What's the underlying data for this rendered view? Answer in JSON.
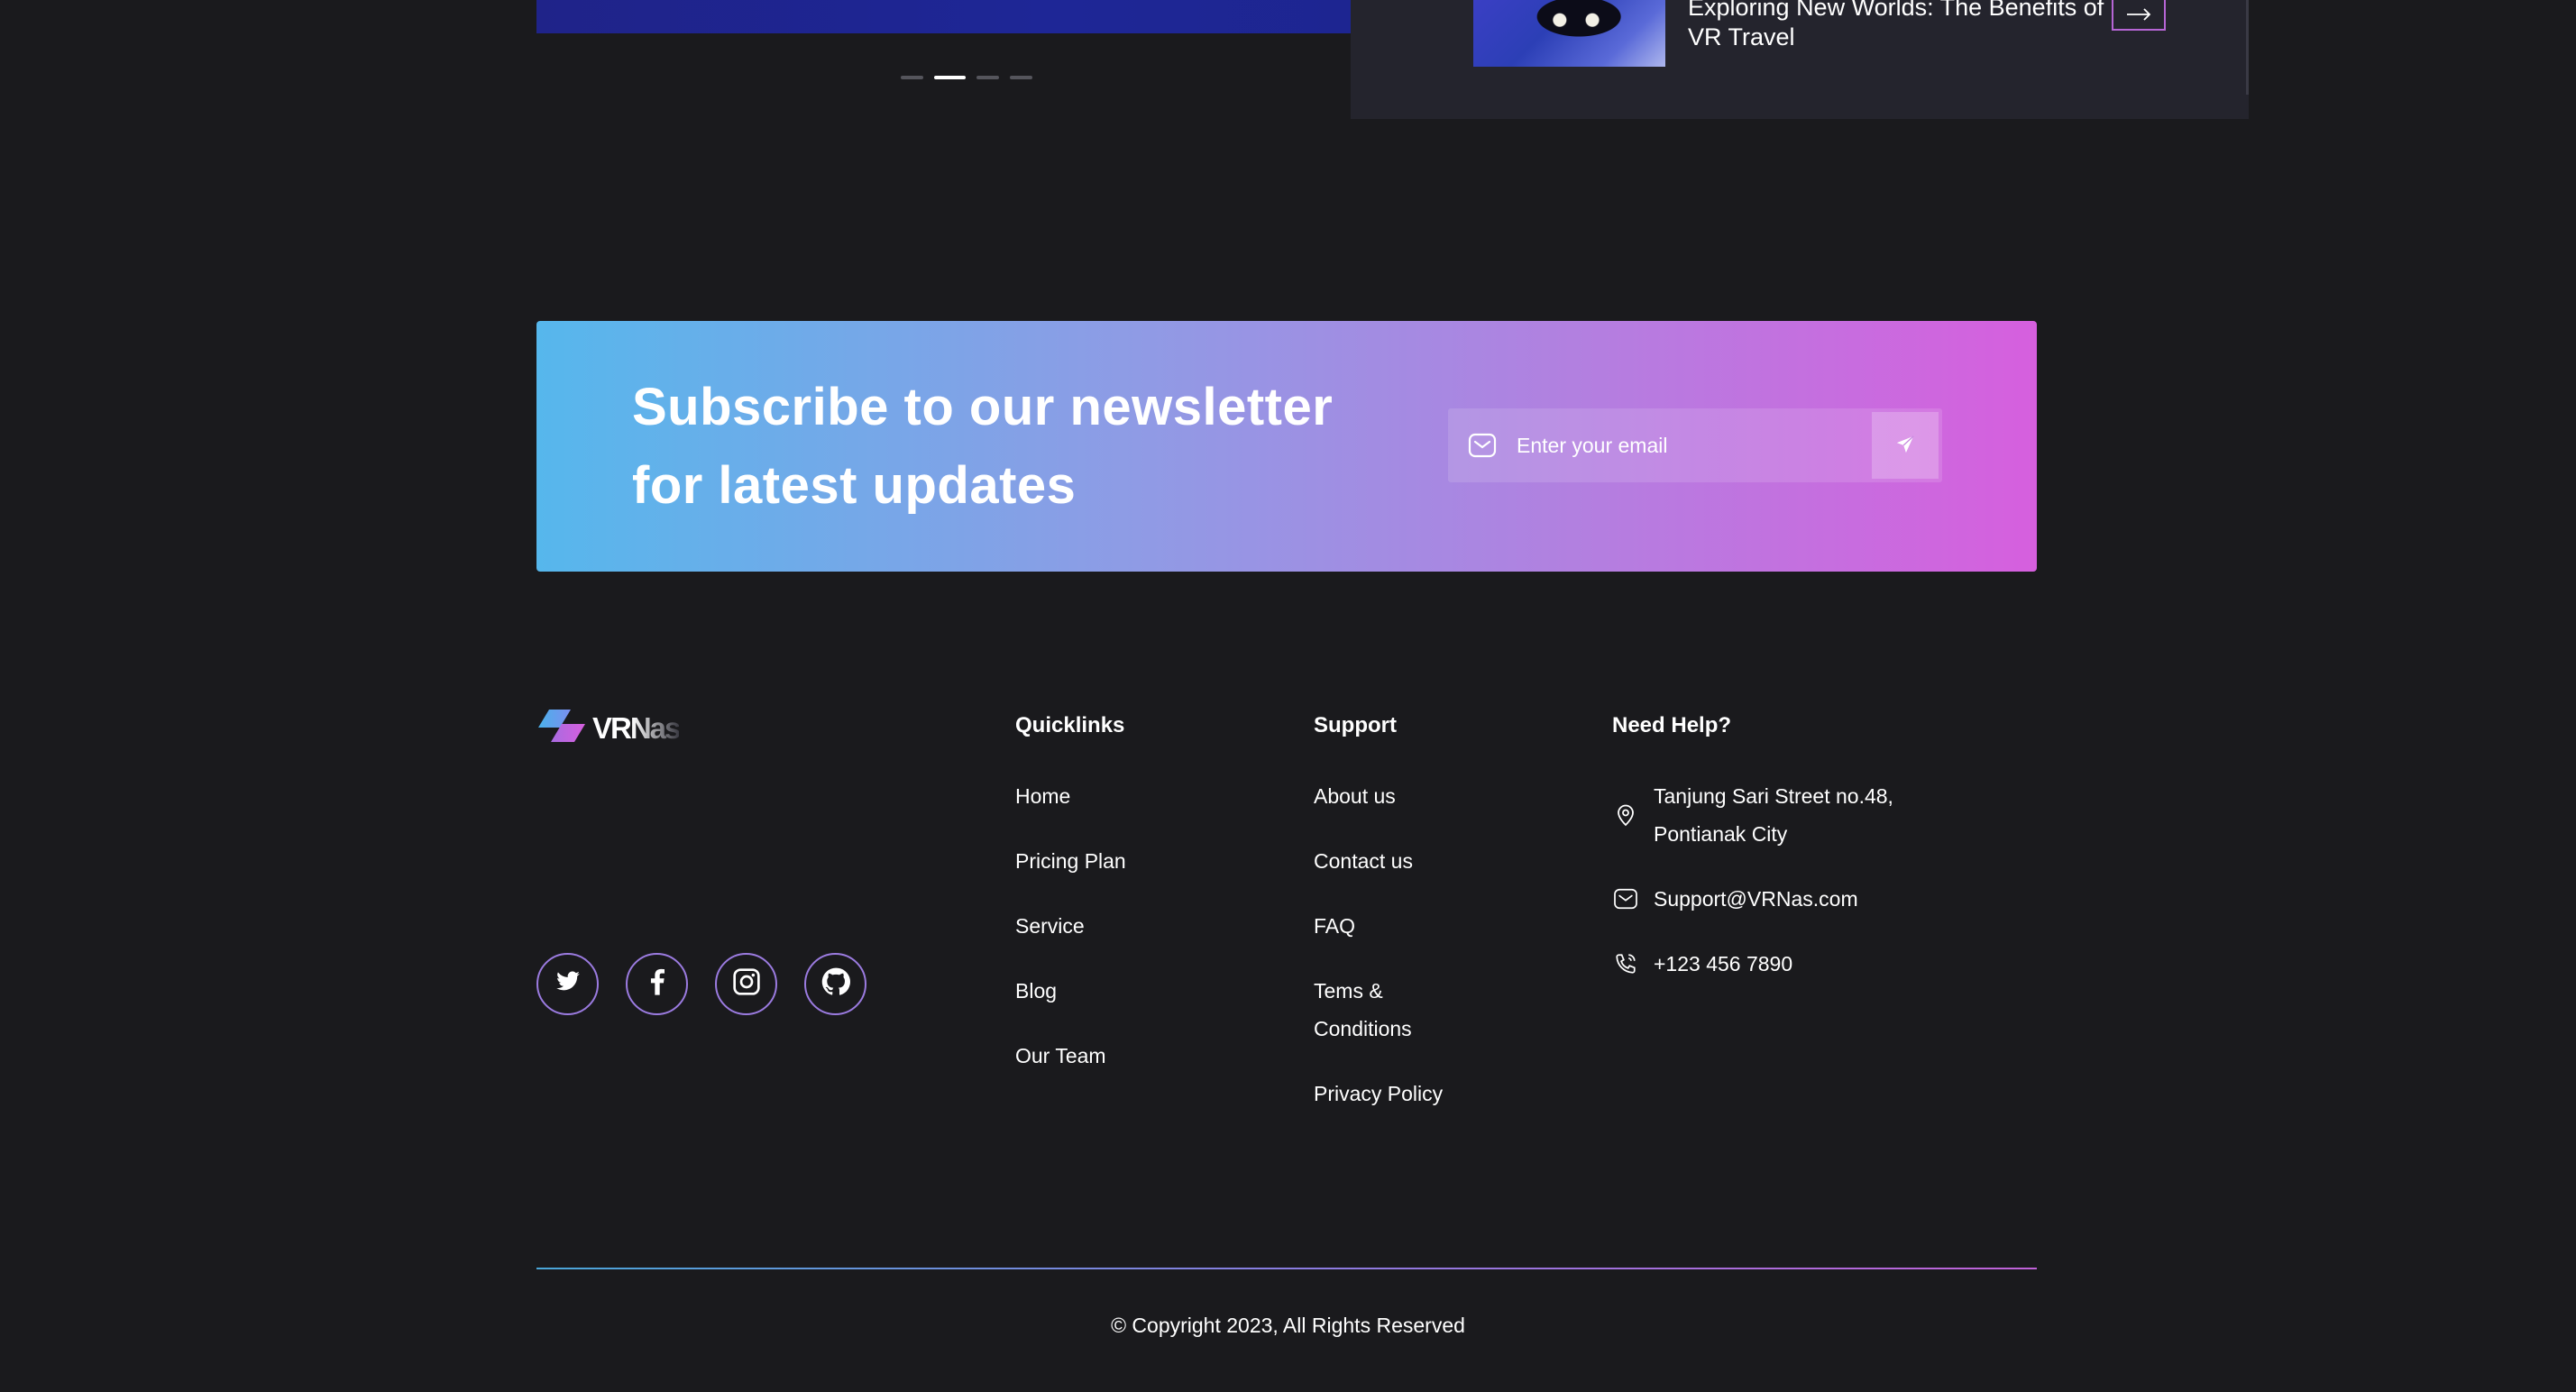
{
  "blog": {
    "title": "Exploring New Worlds: The Benefits of VR Travel"
  },
  "carousel": {
    "dots": 4,
    "active_index": 1
  },
  "newsletter": {
    "title": "Subscribe to our newsletter for latest updates",
    "email_placeholder": "Enter your email",
    "icons": [
      "mail-icon",
      "send-icon"
    ]
  },
  "footer": {
    "logo_text": "VRNas",
    "socials": [
      "twitter-icon",
      "facebook-icon",
      "instagram-icon",
      "github-icon"
    ],
    "quicklinks": {
      "heading": "Quicklinks",
      "items": [
        "Home",
        "Pricing Plan",
        "Service",
        "Blog",
        "Our Team"
      ]
    },
    "support": {
      "heading": "Support",
      "items": [
        "About us",
        "Contact us",
        "FAQ",
        "Tems & Conditions",
        "Privacy Policy"
      ]
    },
    "help": {
      "heading": "Need Help?",
      "address": "Tanjung Sari Street no.48, Pontianak City",
      "email": "Support@VRNas.com",
      "phone": "+123 456 7890"
    },
    "copyright": "© Copyright 2023, All Rights Reserved"
  },
  "colors": {
    "background": "#1a1a1d",
    "gradient_start": "#56b7ec",
    "gradient_end": "#d65fde"
  }
}
